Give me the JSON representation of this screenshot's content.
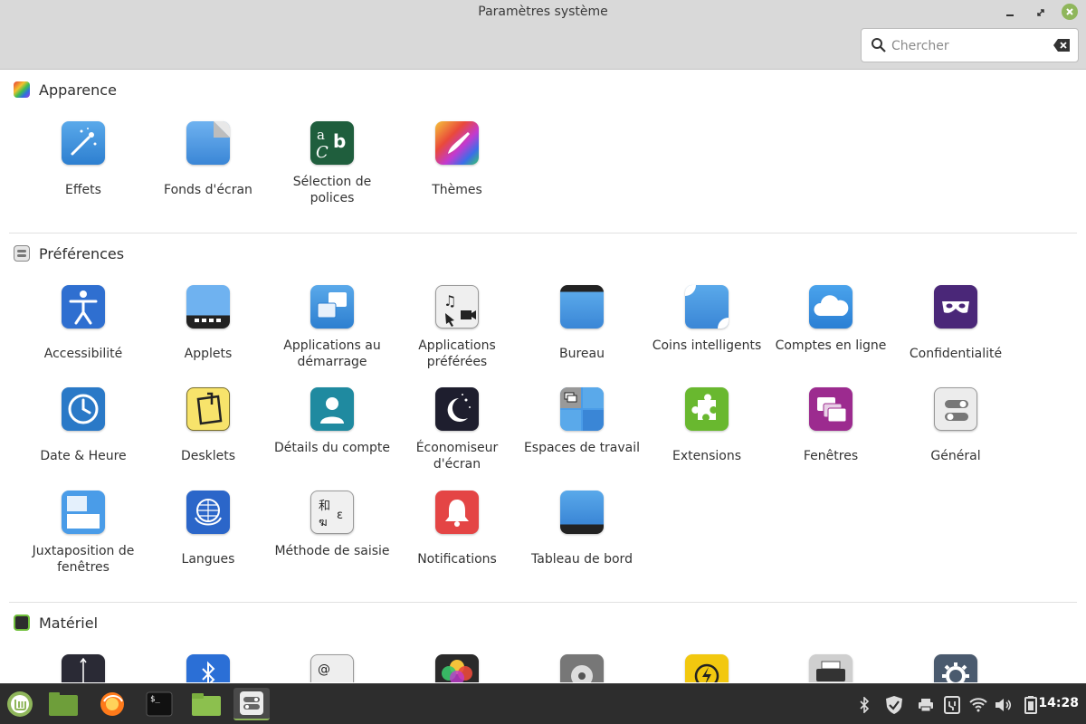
{
  "window": {
    "title": "Paramètres système",
    "search": {
      "placeholder": "Chercher",
      "value": ""
    }
  },
  "sections": [
    {
      "title": "Apparence",
      "icon": "appearance-icon",
      "items": [
        {
          "label": "Effets",
          "icon": "effects-icon"
        },
        {
          "label": "Fonds d'écran",
          "icon": "wallpaper-icon"
        },
        {
          "label": "Sélection de polices",
          "icon": "font-selection-icon"
        },
        {
          "label": "Thèmes",
          "icon": "themes-icon"
        }
      ]
    },
    {
      "title": "Préférences",
      "icon": "preferences-icon",
      "items": [
        {
          "label": "Accessibilité",
          "icon": "accessibility-icon"
        },
        {
          "label": "Applets",
          "icon": "applets-icon"
        },
        {
          "label": "Applications au démarrage",
          "icon": "startup-applications-icon"
        },
        {
          "label": "Applications préférées",
          "icon": "preferred-applications-icon"
        },
        {
          "label": "Bureau",
          "icon": "desktop-icon"
        },
        {
          "label": "Coins intelligents",
          "icon": "hot-corners-icon"
        },
        {
          "label": "Comptes en ligne",
          "icon": "online-accounts-icon"
        },
        {
          "label": "Confidentialité",
          "icon": "privacy-icon"
        },
        {
          "label": "Date & Heure",
          "icon": "clock-icon"
        },
        {
          "label": "Desklets",
          "icon": "desklets-icon"
        },
        {
          "label": "Détails du compte",
          "icon": "account-details-icon"
        },
        {
          "label": "Économiseur d'écran",
          "icon": "screensaver-icon"
        },
        {
          "label": "Espaces de travail",
          "icon": "workspaces-icon"
        },
        {
          "label": "Extensions",
          "icon": "extensions-icon"
        },
        {
          "label": "Fenêtres",
          "icon": "windows-icon"
        },
        {
          "label": "Général",
          "icon": "general-icon"
        },
        {
          "label": "Juxtaposition de fenêtres",
          "icon": "window-tiling-icon"
        },
        {
          "label": "Langues",
          "icon": "languages-icon"
        },
        {
          "label": "Méthode de saisie",
          "icon": "input-method-icon"
        },
        {
          "label": "Notifications",
          "icon": "notifications-icon"
        },
        {
          "label": "Tableau de bord",
          "icon": "panel-icon"
        }
      ]
    },
    {
      "title": "Matériel",
      "icon": "hardware-icon",
      "items": [
        {
          "label": "",
          "icon": "display-icon"
        },
        {
          "label": "",
          "icon": "bluetooth-icon"
        },
        {
          "label": "",
          "icon": "keyboard-icon"
        },
        {
          "label": "",
          "icon": "color-icon"
        },
        {
          "label": "",
          "icon": "disks-icon"
        },
        {
          "label": "",
          "icon": "power-icon"
        },
        {
          "label": "",
          "icon": "printers-icon"
        },
        {
          "label": "",
          "icon": "system-settings-icon"
        }
      ]
    }
  ],
  "taskbar": {
    "apps": [
      "menu-icon",
      "files-icon",
      "firefox-icon",
      "terminal-icon",
      "folder-icon",
      "system-settings-icon"
    ],
    "tray": [
      "bluetooth-icon",
      "shield-icon",
      "printer-icon",
      "usb-icon",
      "wifi-icon",
      "volume-icon",
      "battery-icon"
    ],
    "clock": "14:28"
  },
  "colors": {
    "accent": "#8fb65b",
    "titlebar": "#d9d9d9",
    "taskbar": "#2d2d2d"
  }
}
